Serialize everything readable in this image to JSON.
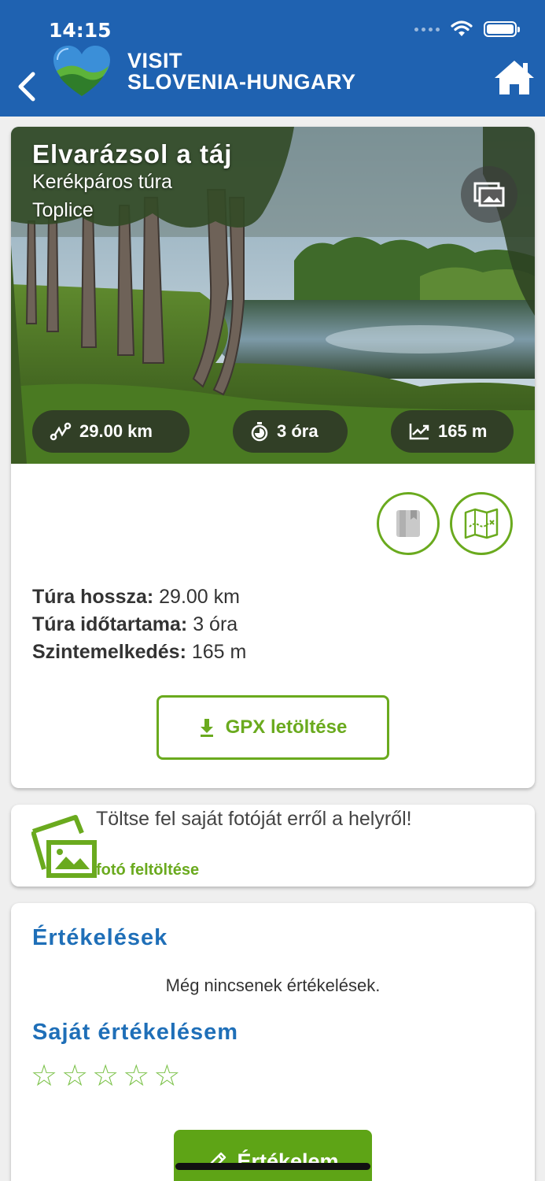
{
  "status_bar": {
    "time": "14:15"
  },
  "header": {
    "brand_line1": "VISIT",
    "brand_line2": "SLOVENIA-HUNGARY"
  },
  "hero": {
    "title": "Elvarázsol a táj",
    "type": "Kerékpáros túra",
    "location": "Toplice",
    "stats": [
      {
        "icon": "route-icon",
        "value": "29.00 km"
      },
      {
        "icon": "stopwatch-icon",
        "value": "3 óra"
      },
      {
        "icon": "elevation-chart-icon",
        "value": "165 m"
      }
    ]
  },
  "details": {
    "length_label": "Túra hossza:",
    "length_value": " 29.00 km",
    "duration_label": "Túra időtartama:",
    "duration_value": " 3 óra",
    "elevation_label": "Szintemelkedés:",
    "elevation_value": " 165 m",
    "gpx_button": "GPX letöltése"
  },
  "upload": {
    "prompt": "Töltse fel saját fotóját erről a helyről!",
    "link": "fotó feltöltése"
  },
  "reviews": {
    "title": "Értékelések",
    "empty_text": "Még nincsenek értékelések.",
    "my_review_title": "Saját értékelésem",
    "rating": 0,
    "max_rating": 5,
    "rate_button": "Értékelem"
  },
  "colors": {
    "header_blue": "#1f62b1",
    "accent_green": "#6aaa1e",
    "title_blue": "#1f6fb8"
  }
}
